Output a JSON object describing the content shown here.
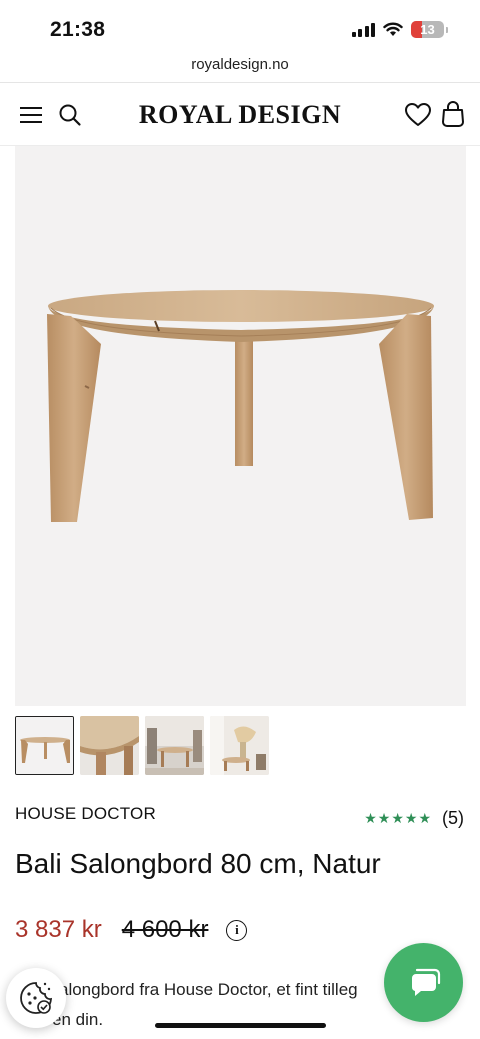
{
  "status_bar": {
    "time": "21:38",
    "battery": "13",
    "icons": [
      "signal-icon",
      "wifi-icon",
      "battery-icon"
    ]
  },
  "browser": {
    "url": "royaldesign.no"
  },
  "header": {
    "logo": "ROYAL DESIGN",
    "icons": [
      "menu-icon",
      "search-icon",
      "heart-icon",
      "shopping-bag-icon"
    ]
  },
  "gallery": {
    "thumbnail_count": 4,
    "active_thumbnail": 1
  },
  "product": {
    "brand": "HOUSE DOCTOR",
    "rating_stars": "★★★★★",
    "rating_value": 5,
    "rating_count": "(5)",
    "title": "Bali Salongbord 80 cm, Natur",
    "price": "3 837 kr",
    "old_price": "4 600 kr",
    "info_icon": "i",
    "description": "alongbord fra House Doctor, et fint tilleg",
    "description_line2": "en din."
  },
  "colors": {
    "price": "#a9342a",
    "stars": "#2f8f57",
    "chat_button": "#44b36b",
    "image_background": "#f3f2f2"
  }
}
